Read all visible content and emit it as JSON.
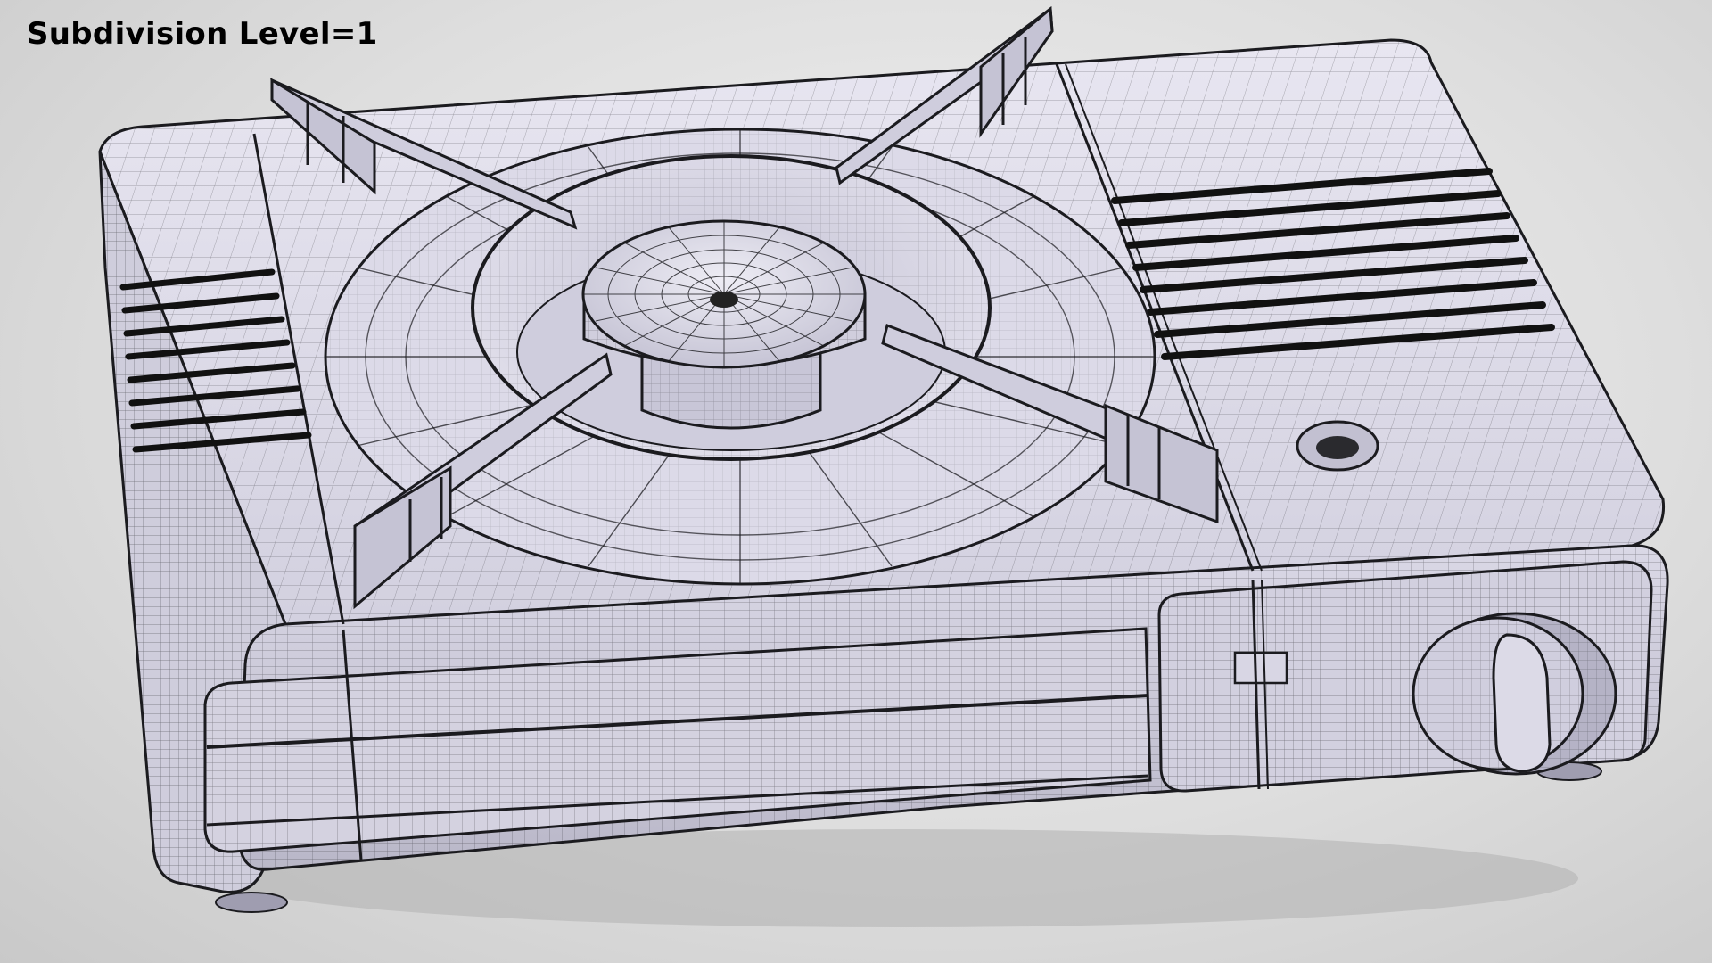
{
  "overlay": {
    "label": "Subdivision Level=1"
  },
  "scene": {
    "subject": "portable-gas-stove-wireframe",
    "colors": {
      "background": "#e4e4e4",
      "shell": "#d6d4e2",
      "shell_light": "#e6e4f0",
      "shell_dark": "#9f9db0",
      "wire": "#1b1b1f",
      "shadow": "#b5b5b5"
    }
  }
}
